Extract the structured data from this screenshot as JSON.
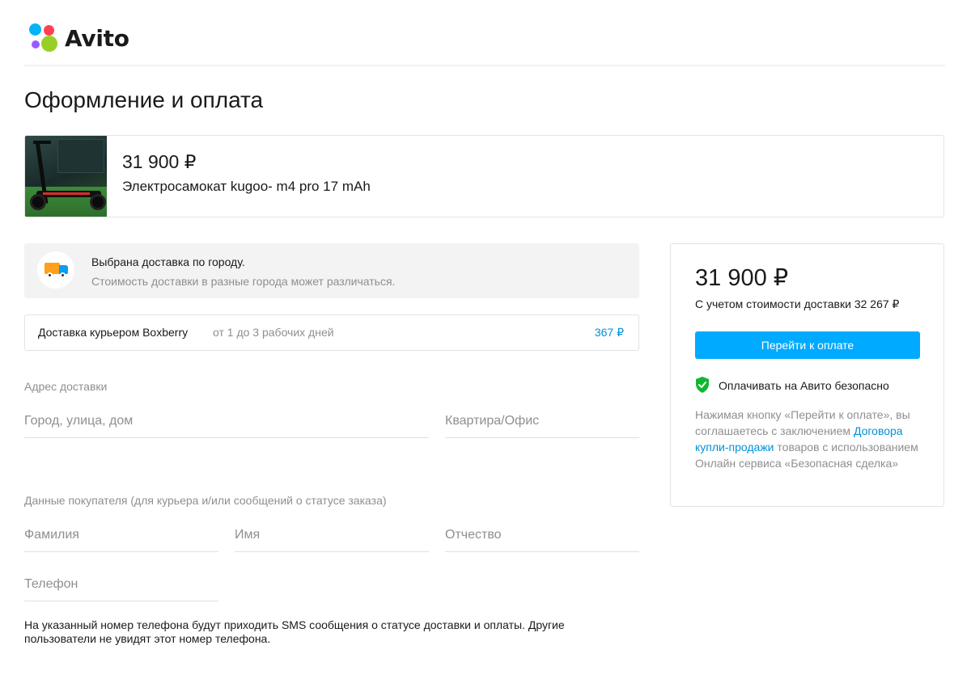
{
  "header": {
    "logo_text": "Avito",
    "logo_colors": [
      "#04b3f7",
      "#ff4052",
      "#985dff",
      "#97cf26"
    ]
  },
  "page": {
    "title": "Оформление и оплата"
  },
  "product": {
    "price": "31 900 ₽",
    "title": "Электросамокат kugoo- m4 pro 17 mAh",
    "image_icon": "scooter-photo"
  },
  "delivery_info": {
    "icon": "truck-icon",
    "title": "Выбрана доставка по городу.",
    "note": "Стоимость доставки в разные города может различаться."
  },
  "delivery_option": {
    "name": "Доставка курьером Boxberry",
    "days": "от 1 до 3 рабочих дней",
    "price": "367 ₽"
  },
  "address": {
    "label": "Адрес доставки",
    "city_placeholder": "Город, улица, дом",
    "apartment_placeholder": "Квартира/Офис"
  },
  "buyer": {
    "label": "Данные покупателя (для курьера и/или сообщений о статусе заказа)",
    "last_name_placeholder": "Фамилия",
    "first_name_placeholder": "Имя",
    "patronymic_placeholder": "Отчество",
    "phone_placeholder": "Телефон",
    "sms_note": "На указанный номер телефона будут приходить SMS сообщения о статусе доставки и оплаты. Другие пользователи не увидят этот номер телефона."
  },
  "summary": {
    "price": "31 900 ₽",
    "note": "С учетом стоимости доставки 32 267 ₽",
    "pay_button": "Перейти к оплате",
    "safe_text": "Оплачивать на Авито безопасно",
    "shield_color": "#0fb82f",
    "terms_before": "Нажимая кнопку «Перейти к оплате», вы соглашаетесь с заключением ",
    "terms_link": "Договора купли-продажи",
    "terms_after": " товаров с использованием Онлайн сервиса «Безопасная сделка»"
  }
}
